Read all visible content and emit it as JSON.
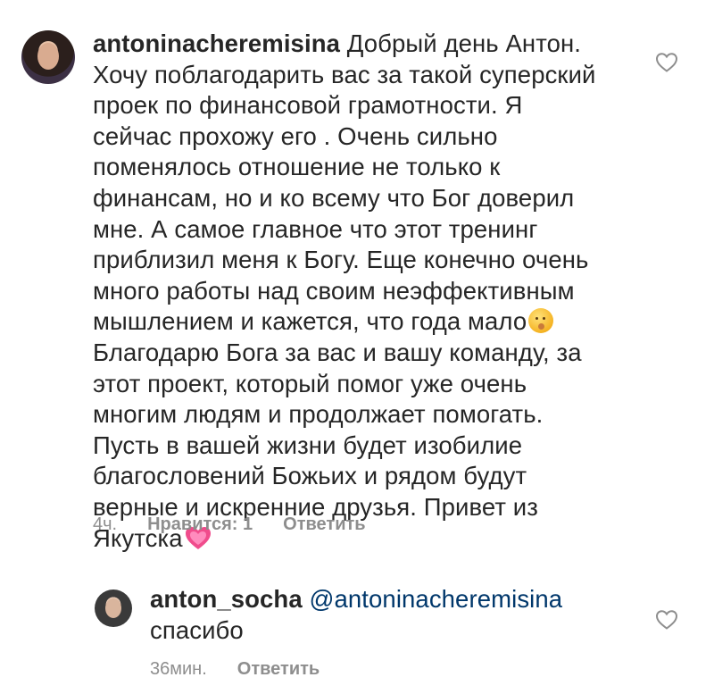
{
  "comments": [
    {
      "username": "antoninacheremisina",
      "lines": [
        "Добрый день Антон.",
        "Хочу поблагодарить вас за такой суперский",
        "проек по финансовой грамотности. Я",
        "сейчас прохожу его . Очень сильно",
        "поменялось отношение не только к",
        "финансам, но и ко всему что Бог доверил",
        "мне. А самое главное что этот тренинг",
        "приблизил меня к Богу. Еще конечно очень",
        "много работы над своим неэффективным",
        "мышлением и кажется, что года мало",
        "Благодарю Бога за вас и вашу команду, за",
        "этот проект, который помог уже очень",
        "многим людям и продолжает помогать.",
        "Пусть в вашей жизни будет изобилие",
        "благословений Божьих и рядом будут",
        "верные и искренние друзья. Привет из",
        "Якутска"
      ],
      "time": "4ч.",
      "likes": "Нравится: 1",
      "reply": "Ответить"
    },
    {
      "username": "anton_socha",
      "mention": "@antoninacheremisina",
      "line2": "спасибо",
      "time": "36мин.",
      "reply": "Ответить"
    }
  ],
  "icons": {
    "like": "heart-outline-icon",
    "emoji1": "face-with-hand-over-mouth-emoji",
    "emoji2": "growing-heart-emoji"
  },
  "colors": {
    "text": "#262626",
    "meta": "#8e8e8e",
    "mention": "#00376b"
  }
}
